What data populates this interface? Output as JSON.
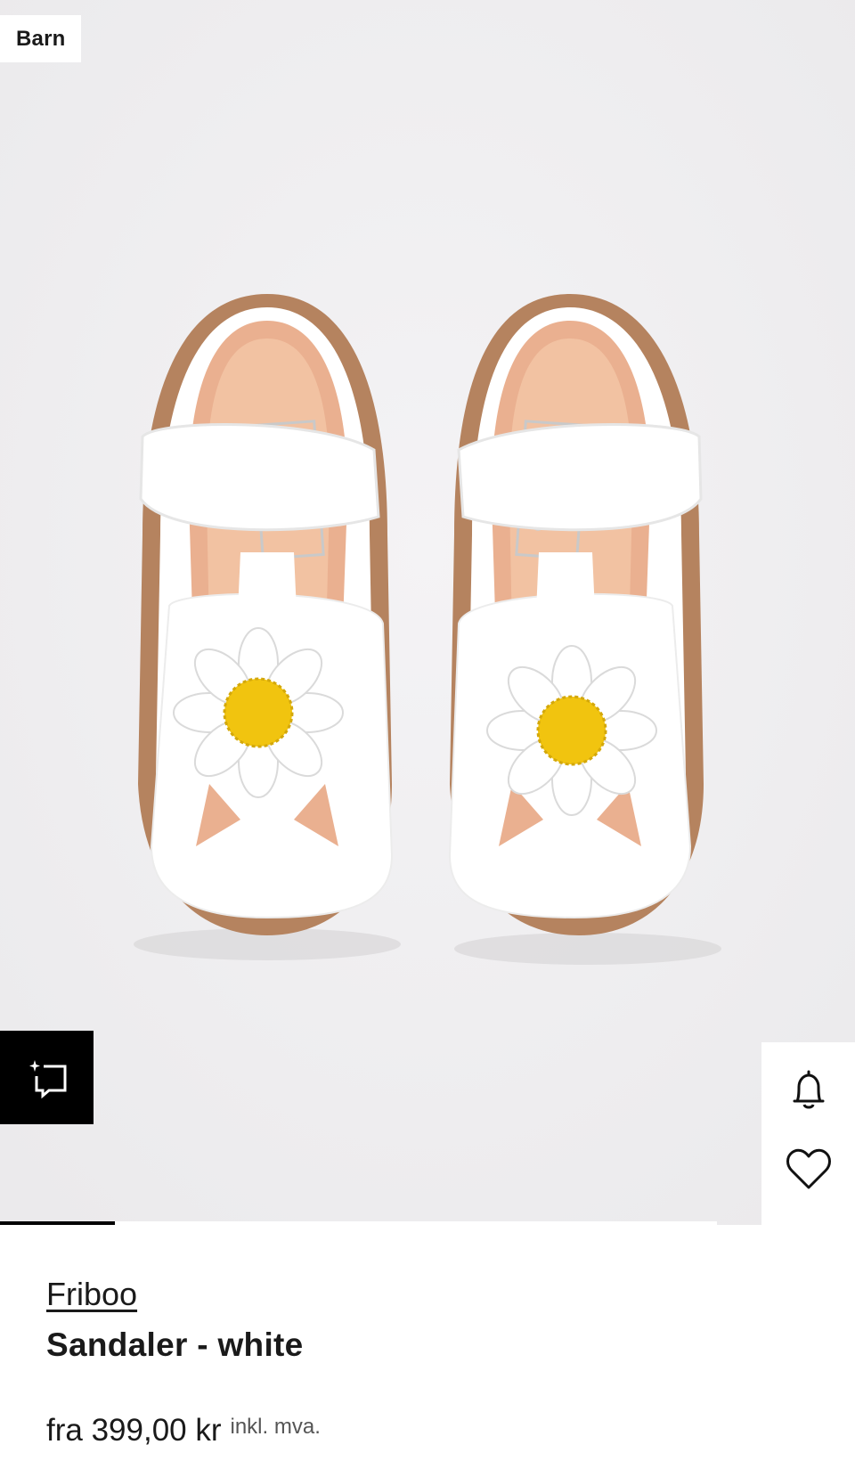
{
  "gallery": {
    "badge": "Barn",
    "image_alt": "Friboo Sandaler - white",
    "image_progress_fraction": 0.16
  },
  "actions": {
    "similar_icon": "sparkle-frame-icon",
    "bell_icon": "bell-icon",
    "heart_icon": "heart-icon"
  },
  "product": {
    "brand": "Friboo",
    "name": "Sandaler - white",
    "price": "fra 399,00 kr",
    "vat_note": "inkl. mva."
  }
}
